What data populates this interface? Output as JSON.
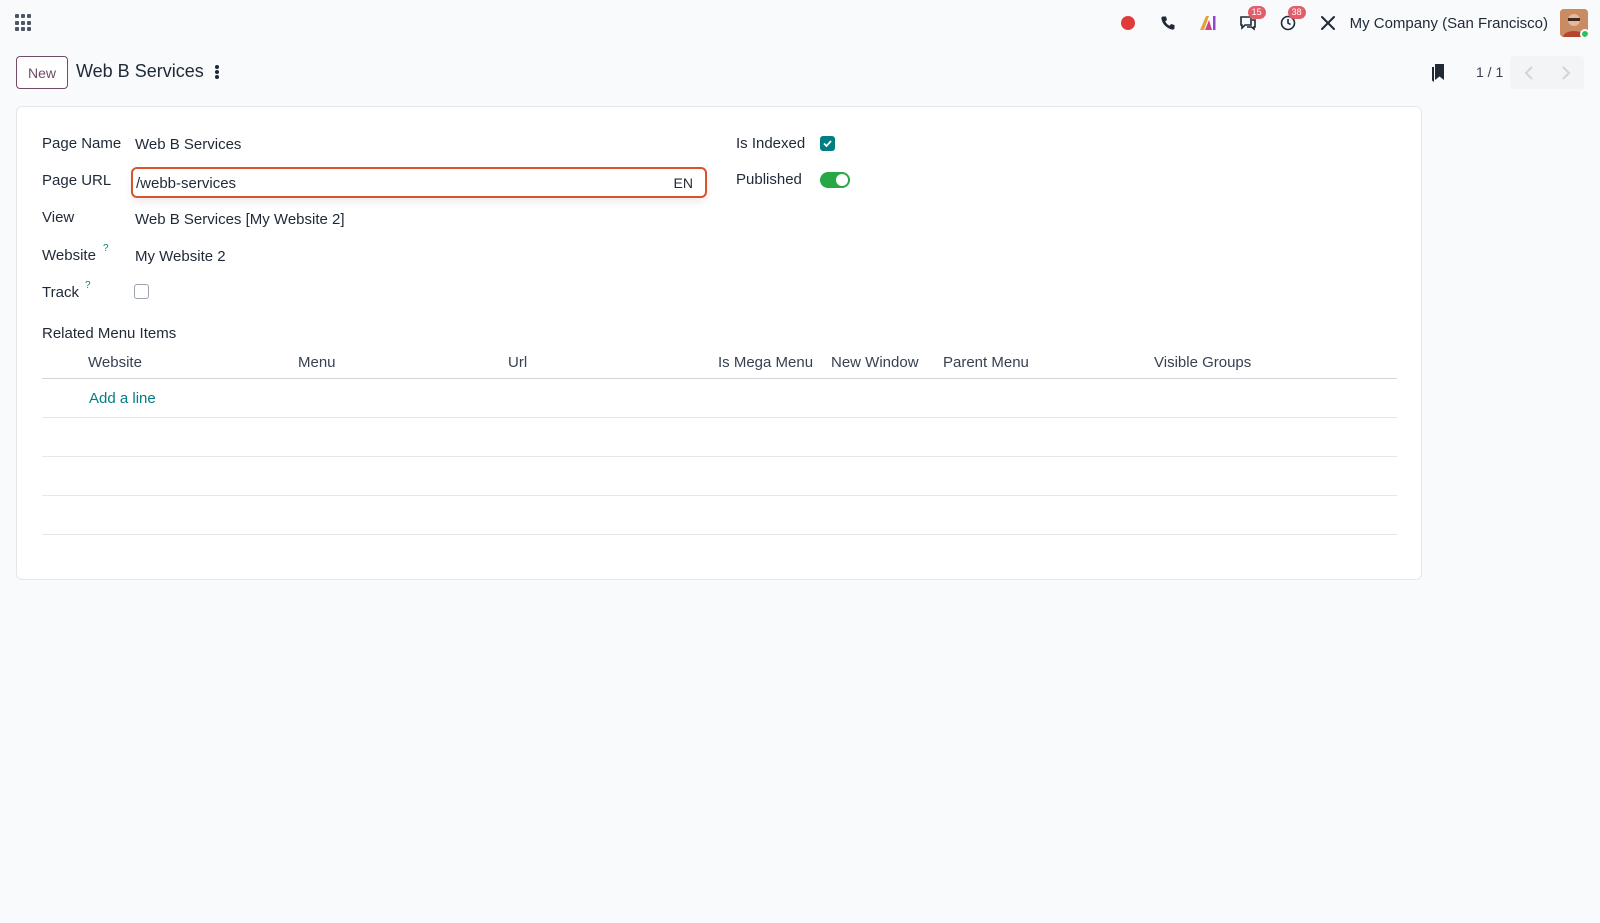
{
  "navbar": {
    "company": "My Company (San Francisco)",
    "messages_badge": "15",
    "activities_badge": "38"
  },
  "control_panel": {
    "new_button": "New",
    "breadcrumb_title": "Web B Services",
    "pager_value": "1 / 1"
  },
  "form": {
    "page_name_label": "Page Name",
    "page_name_value": "Web B Services",
    "page_url_label": "Page URL",
    "page_url_value": "/webb-services",
    "page_url_lang": "EN",
    "view_label": "View",
    "view_value": "Web B Services [My Website 2]",
    "website_label": "Website",
    "website_value": "My Website 2",
    "track_label": "Track",
    "help_mark": "?",
    "is_indexed_label": "Is Indexed",
    "is_indexed": true,
    "published_label": "Published",
    "published": true,
    "track": false
  },
  "related_menu": {
    "label": "Related Menu Items",
    "columns": [
      "Website",
      "Menu",
      "Url",
      "Is Mega Menu",
      "New Window",
      "Parent Menu",
      "Visible Groups"
    ],
    "add_line": "Add a line"
  },
  "colors": {
    "accent": "#017e84",
    "brand": "#714b67",
    "focus_border": "#d9532c",
    "toggle_on": "#28a745"
  }
}
